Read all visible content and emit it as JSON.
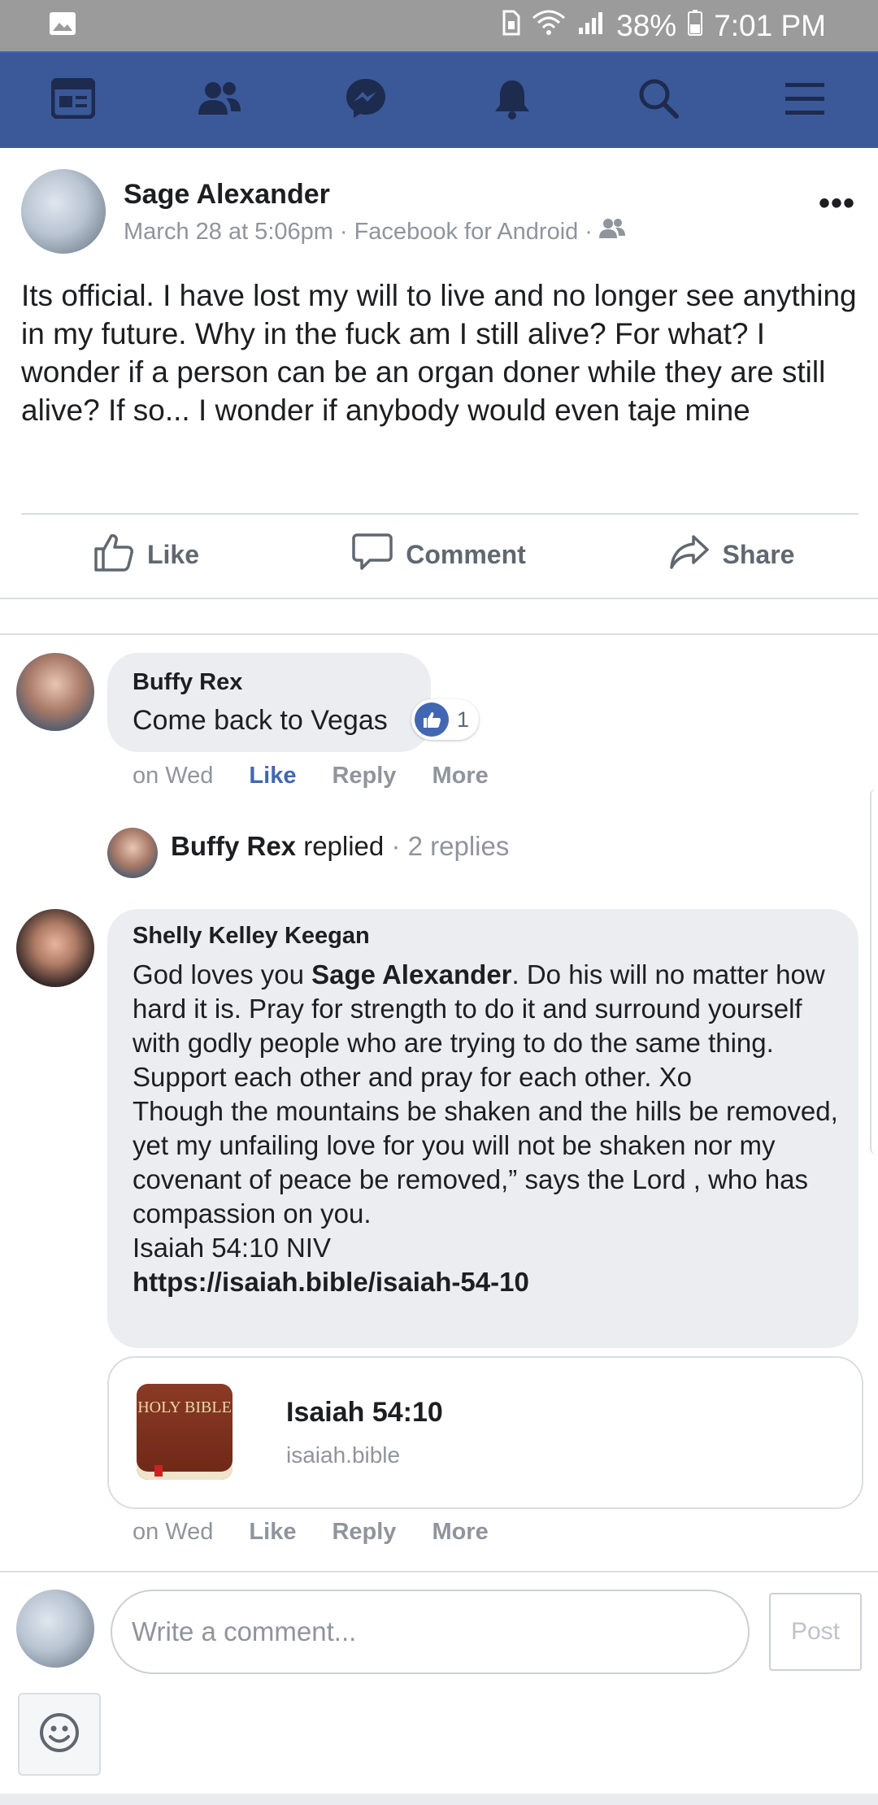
{
  "status_bar": {
    "battery": "38%",
    "time": "7:01 PM"
  },
  "nav": {
    "items": [
      {
        "name": "news-feed-icon"
      },
      {
        "name": "friends-icon"
      },
      {
        "name": "messenger-icon"
      },
      {
        "name": "notifications-icon"
      },
      {
        "name": "search-icon"
      },
      {
        "name": "menu-icon"
      }
    ],
    "colors": {
      "bar": "#3b5998",
      "icon": "#1d2b4f"
    }
  },
  "post": {
    "author": "Sage Alexander",
    "date": "March 28 at 5:06pm",
    "source": "Facebook for Android",
    "audience_icon": "friends-audience-icon",
    "text": "Its official. I have lost my will to live and no longer see anything in my future. Why in the fuck am I still alive? For what? I wonder if a person can be an organ doner while they are still alive? If so... I wonder if anybody would even taje mine",
    "actions": {
      "like": "Like",
      "comment": "Comment",
      "share": "Share"
    }
  },
  "comments": {
    "first": {
      "author": "Buffy Rex",
      "text": "Come back to Vegas",
      "reaction_count": "1",
      "time": "on Wed",
      "like": "Like",
      "reply": "Reply",
      "more": "More"
    },
    "replies_line": {
      "name": "Buffy Rex",
      "verb": "replied",
      "count": "· 2 replies"
    },
    "second": {
      "author": "Shelly Kelley Keegan",
      "text_prefix": "God loves you ",
      "mention": "Sage Alexander",
      "text_1": ". Do his will no matter how hard it is. Pray for strength to do it and surround yourself with godly people who are trying to do the same thing. Support each other and pray for each other. Xo",
      "text_2": "Though the mountains be shaken and the hills be removed, yet my unfailing love for you will not be shaken nor my covenant of peace be removed,” says the Lord , who has compassion on you.",
      "text_3": "Isaiah 54:10 NIV",
      "link": "https://isaiah.bible/isaiah-54-10",
      "card_title": "Isaiah 54:10",
      "card_domain": "isaiah.bible",
      "book_text": "HOLY BIBLE",
      "time": "on Wed",
      "like": "Like",
      "reply": "Reply",
      "more": "More"
    }
  },
  "composer": {
    "placeholder": "Write a comment...",
    "post_label": "Post"
  }
}
